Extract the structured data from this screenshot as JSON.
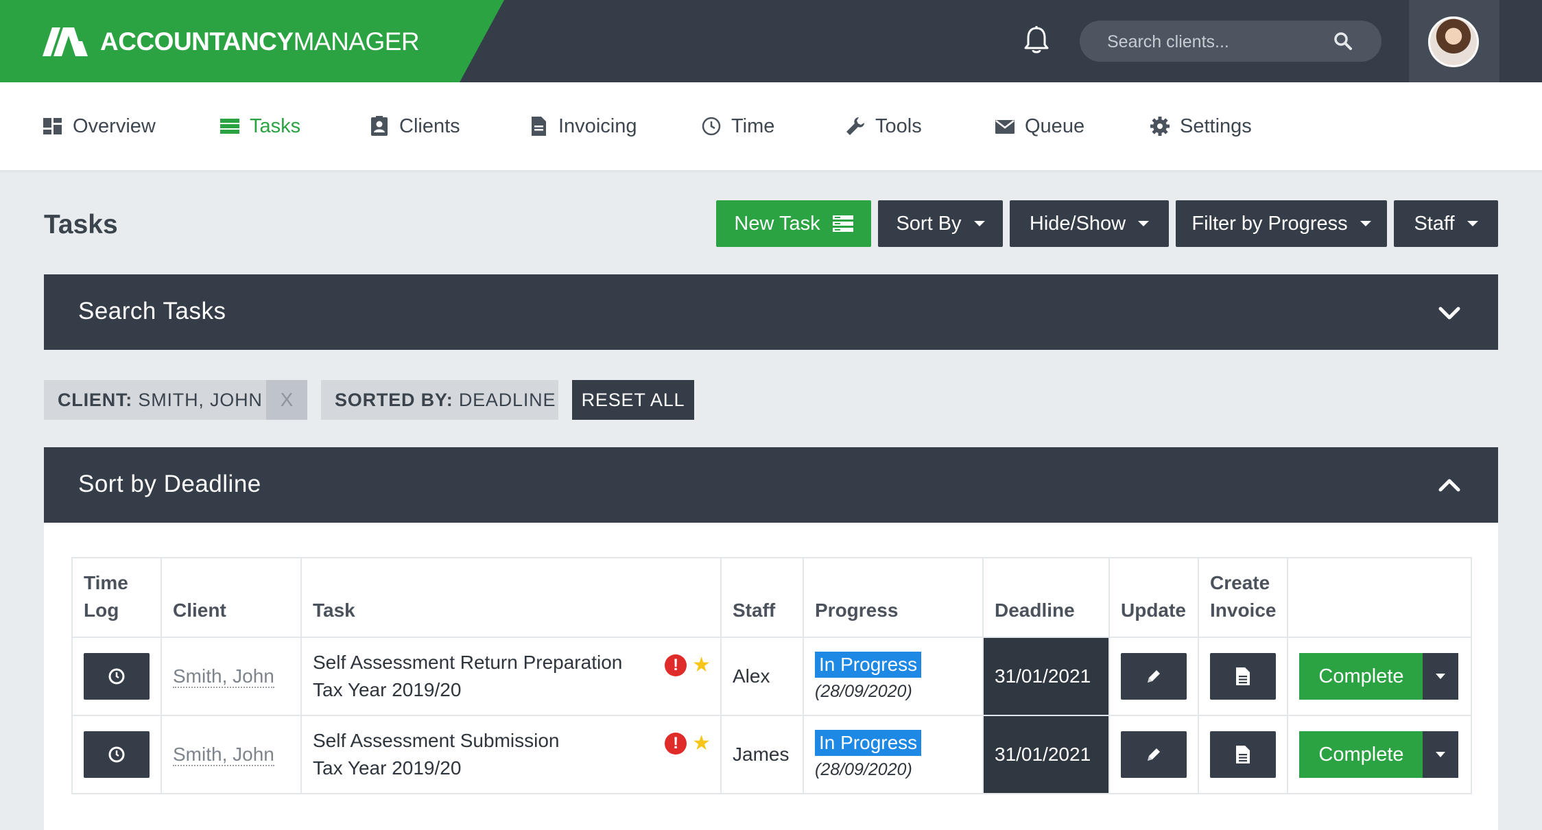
{
  "header": {
    "brand_bold": "ACCOUNTANCY",
    "brand_light": "MANAGER",
    "search_placeholder": "Search clients..."
  },
  "nav": {
    "overview": "Overview",
    "tasks": "Tasks",
    "clients": "Clients",
    "invoicing": "Invoicing",
    "time": "Time",
    "tools": "Tools",
    "queue": "Queue",
    "settings": "Settings",
    "active_color": "#2ca343"
  },
  "page": {
    "title": "Tasks",
    "new_task": "New Task",
    "sort_by": "Sort By",
    "hide_show": "Hide/Show",
    "filter_progress": "Filter by Progress",
    "staff": "Staff"
  },
  "search_panel": {
    "title": "Search Tasks"
  },
  "filters": {
    "client_key": "CLIENT:",
    "client_value": "SMITH, JOHN",
    "client_remove": "X",
    "sorted_key": "SORTED BY:",
    "sorted_value": "DEADLINE",
    "reset": "RESET ALL"
  },
  "sort_panel": {
    "title": "Sort by Deadline"
  },
  "table": {
    "headers": {
      "time_log_1": "Time",
      "time_log_2": "Log",
      "client": "Client",
      "task": "Task",
      "staff": "Staff",
      "progress": "Progress",
      "deadline": "Deadline",
      "update": "Update",
      "invoice_1": "Create",
      "invoice_2": "Invoice"
    },
    "rows": [
      {
        "client": "Smith, John",
        "task_line1": "Self Assessment Return Preparation",
        "task_line2": "Tax Year 2019/20",
        "alert": "!",
        "star": "★",
        "staff": "Alex",
        "progress": "In Progress",
        "progress_date": "(28/09/2020)",
        "deadline": "31/01/2021",
        "complete": "Complete"
      },
      {
        "client": "Smith, John",
        "task_line1": "Self Assessment Submission",
        "task_line2": "Tax Year 2019/20",
        "alert": "!",
        "star": "★",
        "staff": "James",
        "progress": "In Progress",
        "progress_date": "(28/09/2020)",
        "deadline": "31/01/2021",
        "complete": "Complete"
      }
    ]
  }
}
